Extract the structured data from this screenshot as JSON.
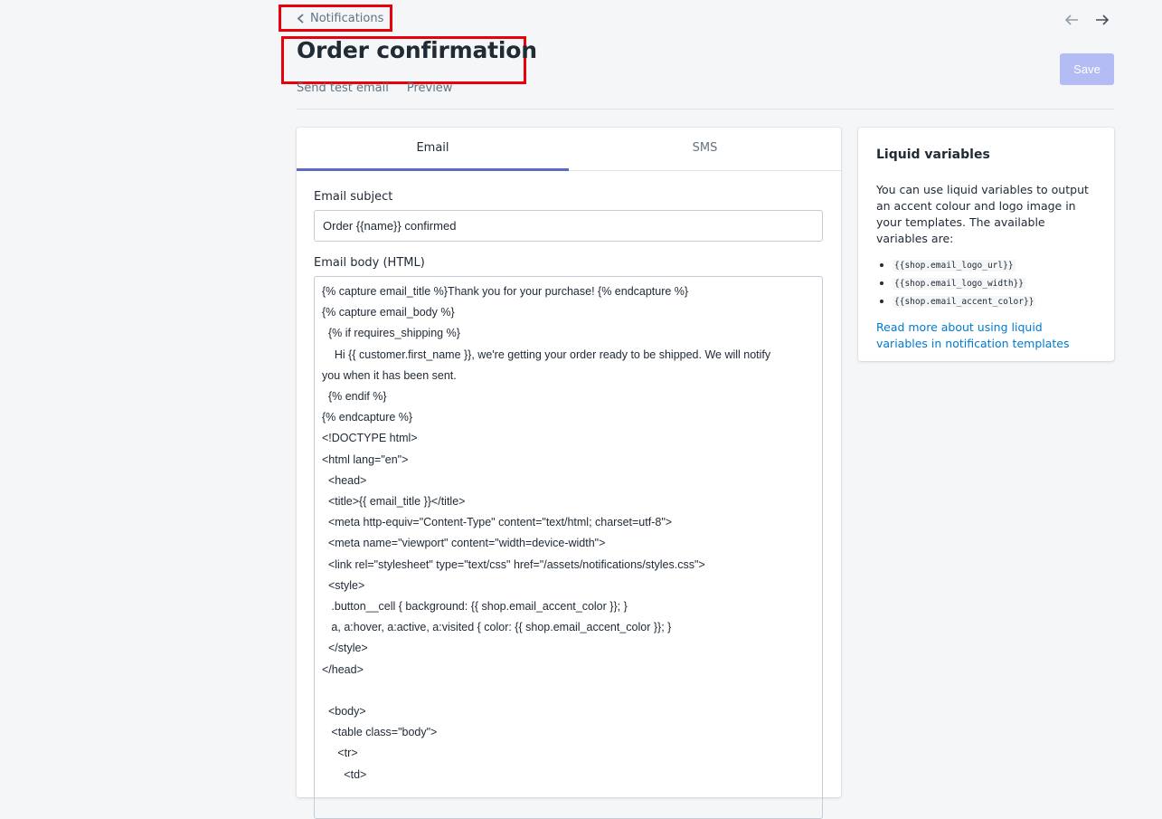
{
  "header": {
    "back_label": "Notifications",
    "title": "Order confirmation",
    "actions": [
      "Send test email",
      "Preview"
    ],
    "save_label": "Save"
  },
  "tabs": [
    {
      "label": "Email",
      "active": true
    },
    {
      "label": "SMS",
      "active": false
    }
  ],
  "form": {
    "subject_label": "Email subject",
    "subject_value": "Order {{name}} confirmed",
    "body_label": "Email body (HTML)",
    "body_lines": [
      "{% capture email_title %}Thank you for your purchase! {% endcapture %}",
      "{% capture email_body %}",
      "  {% if requires_shipping %}",
      "    Hi {{ customer.first_name }}, we're getting your order ready to be shipped. We will notify",
      "you when it has been sent.",
      "  {% endif %}",
      "{% endcapture %}",
      "<!DOCTYPE html>",
      "<html lang=\"en\">",
      "  <head>",
      "  <title>{{ email_title }}</title>",
      "  <meta http-equiv=\"Content-Type\" content=\"text/html; charset=utf-8\">",
      "  <meta name=\"viewport\" content=\"width=device-width\">",
      "  <link rel=\"stylesheet\" type=\"text/css\" href=\"/assets/notifications/styles.css\">",
      "  <style>",
      "   .button__cell { background: {{ shop.email_accent_color }}; }",
      "   a, a:hover, a:active, a:visited { color: {{ shop.email_accent_color }}; }",
      "  </style>",
      "</head>",
      "",
      "  <body>",
      "   <table class=\"body\">",
      "     <tr>",
      "       <td>"
    ]
  },
  "sidebar": {
    "title": "Liquid variables",
    "description": "You can use liquid variables to output an accent colour and logo image in your templates. The available variables are:",
    "variables": [
      "{{shop.email_logo_url}}",
      "{{shop.email_logo_width}}",
      "{{shop.email_accent_color}}"
    ],
    "link_text": "Read more about using liquid variables in notification templates"
  },
  "icons": {
    "back": "chevron-left-icon",
    "prev": "arrow-left-icon",
    "next": "arrow-right-icon"
  },
  "colors": {
    "highlight": "#e8000b",
    "accent": "#5c6ac4",
    "save_disabled": "#b3bcf5",
    "link": "#007ace"
  }
}
